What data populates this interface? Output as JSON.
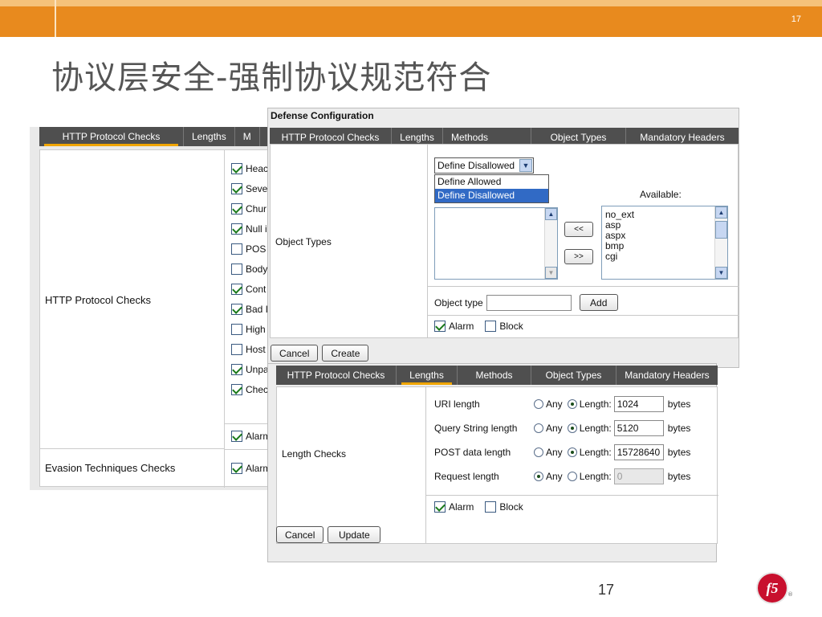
{
  "slide": {
    "title": "协议层安全-强制协议规范符合",
    "top_number": "17",
    "bottom_number": "17",
    "logo_text": "f5",
    "colors": {
      "band": "#e88a1e",
      "band_light": "#f5c27a",
      "tab_bar": "#4f4f4f",
      "tab_accent": "#f0a500",
      "logo": "#c8102e"
    }
  },
  "back_panel": {
    "tabs": [
      {
        "label": "HTTP Protocol Checks",
        "active": true
      },
      {
        "label": "Lengths",
        "active": false
      },
      {
        "label": "M",
        "active": false
      }
    ],
    "section1_label": "HTTP Protocol Checks",
    "section2_label": "Evasion Techniques Checks",
    "checks": [
      {
        "label": "Heac",
        "checked": true
      },
      {
        "label": "Seve",
        "checked": true
      },
      {
        "label": "Chur",
        "checked": true
      },
      {
        "label": "Null ir",
        "checked": true
      },
      {
        "label": "POS",
        "checked": false
      },
      {
        "label": "Body",
        "checked": false
      },
      {
        "label": "Cont",
        "checked": true
      },
      {
        "label": "Bad I",
        "checked": true
      },
      {
        "label": "High",
        "checked": false
      },
      {
        "label": "Host",
        "checked": false
      },
      {
        "label": "Unpar",
        "checked": true
      },
      {
        "label": "Checl",
        "checked": true
      }
    ],
    "alarm1": "Alarm",
    "alarm2": "Alarm"
  },
  "top_panel": {
    "header": "Defense Configuration",
    "tabs": [
      {
        "label": "HTTP Protocol Checks",
        "active": false
      },
      {
        "label": "Lengths",
        "active": false
      },
      {
        "label": "Methods",
        "active": false
      },
      {
        "label": "Object Types",
        "active": true
      },
      {
        "label": "Mandatory Headers",
        "active": false
      }
    ],
    "section_label": "Object Types",
    "select_value": "Define Disallowed",
    "dropdown_options": [
      "Define Allowed",
      "Define Disallowed"
    ],
    "available_label": "Available:",
    "move_left_label": "<<",
    "move_right_label": ">>",
    "available_items": [
      "no_ext",
      "asp",
      "aspx",
      "bmp",
      "cgi"
    ],
    "object_type_label": "Object type",
    "add_label": "Add",
    "alarm_label": "Alarm",
    "alarm_checked": true,
    "block_label": "Block",
    "block_checked": false,
    "cancel_label": "Cancel",
    "create_label": "Create"
  },
  "bottom_panel": {
    "tabs": [
      {
        "label": "HTTP Protocol Checks",
        "active": false
      },
      {
        "label": "Lengths",
        "active": true
      },
      {
        "label": "Methods",
        "active": false
      },
      {
        "label": "Object Types",
        "active": false
      },
      {
        "label": "Mandatory Headers",
        "active": false
      }
    ],
    "section_label": "Length Checks",
    "any_label": "Any",
    "length_label": "Length:",
    "unit": "bytes",
    "rows": [
      {
        "label": "URI length",
        "mode": "length",
        "value": "1024"
      },
      {
        "label": "Query String length",
        "mode": "length",
        "value": "5120"
      },
      {
        "label": "POST data length",
        "mode": "length",
        "value": "15728640"
      },
      {
        "label": "Request length",
        "mode": "any",
        "value": "0"
      }
    ],
    "alarm_label": "Alarm",
    "alarm_checked": true,
    "block_label": "Block",
    "block_checked": false,
    "cancel_label": "Cancel",
    "update_label": "Update"
  }
}
